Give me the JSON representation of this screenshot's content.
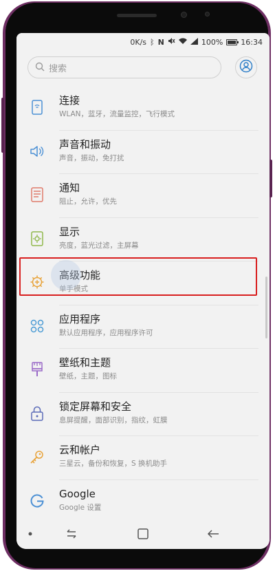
{
  "status_bar": {
    "network_speed": "0K/s",
    "battery_percent": "100%",
    "time": "16:34",
    "icons": [
      "bluetooth-icon",
      "nfc-icon",
      "mute-icon",
      "wifi-icon",
      "signal-icon",
      "battery-icon"
    ]
  },
  "search": {
    "placeholder": "搜索",
    "icon": "search-icon"
  },
  "profile": {
    "icon": "person-icon"
  },
  "settings": [
    {
      "title": "连接",
      "subtitle": "WLAN，蓝牙，流量监控，飞行模式",
      "icon": "connection-icon",
      "color": "#4a8fd4"
    },
    {
      "title": "声音和振动",
      "subtitle": "声音，振动，免打扰",
      "icon": "speaker-icon",
      "color": "#4a8fd4"
    },
    {
      "title": "通知",
      "subtitle": "阻止，允许，优先",
      "icon": "notification-icon",
      "color": "#e07a6a"
    },
    {
      "title": "显示",
      "subtitle": "亮度，蓝光过滤，主屏幕",
      "icon": "display-icon",
      "color": "#8fb84a"
    },
    {
      "title": "高级功能",
      "subtitle": "单手模式",
      "icon": "gear-plus-icon",
      "color": "#e8a33a"
    },
    {
      "title": "应用程序",
      "subtitle": "默认应用程序，应用程序许可",
      "icon": "apps-icon",
      "color": "#4a9bd4"
    },
    {
      "title": "壁纸和主题",
      "subtitle": "壁纸，主题，图标",
      "icon": "brush-icon",
      "color": "#9a6ac8"
    },
    {
      "title": "锁定屏幕和安全",
      "subtitle": "息屏提醒，面部识别，指纹，虹膜",
      "icon": "lock-icon",
      "color": "#5a6ab8"
    },
    {
      "title": "云和帐户",
      "subtitle": "三星云，备份和恢复，S 换机助手",
      "icon": "key-icon",
      "color": "#e8a33a"
    },
    {
      "title": "Google",
      "subtitle": "Google 设置",
      "icon": "google-icon",
      "color": "#4a8fd4"
    }
  ],
  "navigation": {
    "buttons": [
      "dot-icon",
      "recent-apps-icon",
      "home-icon",
      "back-icon"
    ]
  },
  "highlight_color": "#d81e1e",
  "phone_color": "#6e2f63"
}
